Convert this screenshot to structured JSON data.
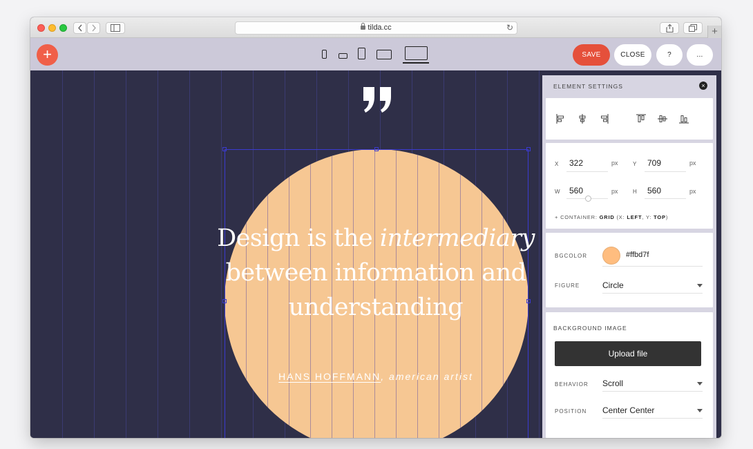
{
  "browser": {
    "url": "tilda.cc",
    "new_tab_label": "+"
  },
  "toolbar": {
    "add_label": "+",
    "save_label": "SAVE",
    "close_label": "CLOSE",
    "help_label": "?",
    "more_label": "..."
  },
  "canvas": {
    "quote_line1_pre": "Design is the ",
    "quote_line1_em": "intermediary",
    "quote_line2": "between information and",
    "quote_line3": "understanding",
    "author_name": "HANS HOFFMANN",
    "author_role": ", american artist",
    "circle_color": "#f6c793",
    "bg_color": "#2f2f48"
  },
  "panel": {
    "title": "ELEMENT SETTINGS",
    "close_label": "×",
    "position": {
      "x_label": "X",
      "x_value": "322",
      "x_unit": "px",
      "y_label": "Y",
      "y_value": "709",
      "y_unit": "px",
      "w_label": "W",
      "w_value": "560",
      "w_unit": "px",
      "h_label": "H",
      "h_value": "560",
      "h_unit": "px"
    },
    "container_note": {
      "prefix": "+ CONTAINER: ",
      "grid": "GRID",
      "open": " (X: ",
      "x": "LEFT",
      "mid": ", Y: ",
      "y": "TOP",
      "close": ")"
    },
    "bgcolor_label": "BGCOLOR",
    "bgcolor_value": "#ffbd7f",
    "figure_label": "FIGURE",
    "figure_value": "Circle",
    "bgimage_title": "BACKGROUND IMAGE",
    "upload_label": "Upload file",
    "behavior_label": "BEHAVIOR",
    "behavior_value": "Scroll",
    "position_label": "POSITION",
    "position_value": "Center Center"
  }
}
